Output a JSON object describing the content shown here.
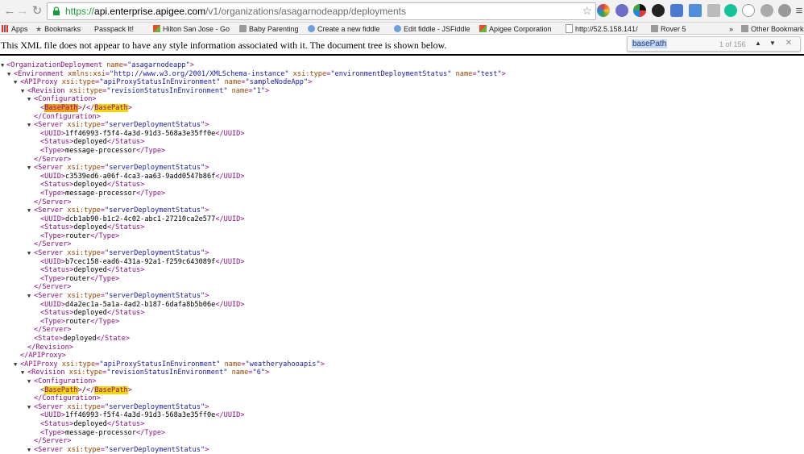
{
  "browser": {
    "url_scheme": "https://",
    "url_host": "api.enterprise.apigee.com",
    "url_path": "/v1/organizations/asagarnodeapp/deployments"
  },
  "bookmarks": {
    "apps": "Apps",
    "bookmarks": "Bookmarks",
    "passpack": "Passpack It!",
    "hilton": "Hilton San Jose - Go",
    "baby": "Baby Parenting",
    "fiddle": "Create a new fiddle",
    "jsfiddle": "Edit fiddle - JSFiddle",
    "apigee": "Apigee Corporation",
    "ip": "http://52.5.158.141/",
    "rover": "Rover 5",
    "more": "»",
    "other": "Other Bookmarks"
  },
  "infobar": {
    "message": "This XML file does not appear to have any style information associated with it. The document tree is shown below."
  },
  "find": {
    "term": "basePath",
    "count": "1 of 156"
  },
  "xml": {
    "org_name": "asagarnodeapp",
    "xmlns_xsi": "http://www.w3.org/2001/XMLSchema-instance",
    "env_type": "environmentDeploymentStatus",
    "env_name": "test",
    "proxy_type": "apiProxyStatusInEnvironment",
    "proxy1_name": "sampleNodeApp",
    "revision_type": "revisionStatusInEnvironment",
    "revision1_name": "1",
    "server_type": "serverDeploymentStatus",
    "basepath_value": "/",
    "uuid1": "1ff46993-f5f4-4a3d-91d3-568a3e35ff0e",
    "uuid2": "c3539ed6-a06f-4ca3-aa63-9add0547b86f",
    "uuid3": "dcb1ab90-b1c2-4c02-abc1-27210ca2e577",
    "uuid4": "b7cec158-ead6-431a-92a1-f259c643089f",
    "uuid5": "d4a2ec1a-5a1a-4ad2-b187-6dafa8b5b06e",
    "status_deployed": "deployed",
    "type_mp": "message-processor",
    "type_router": "router",
    "proxy2_name": "weatheryahooapis",
    "revision2_name": "6"
  }
}
